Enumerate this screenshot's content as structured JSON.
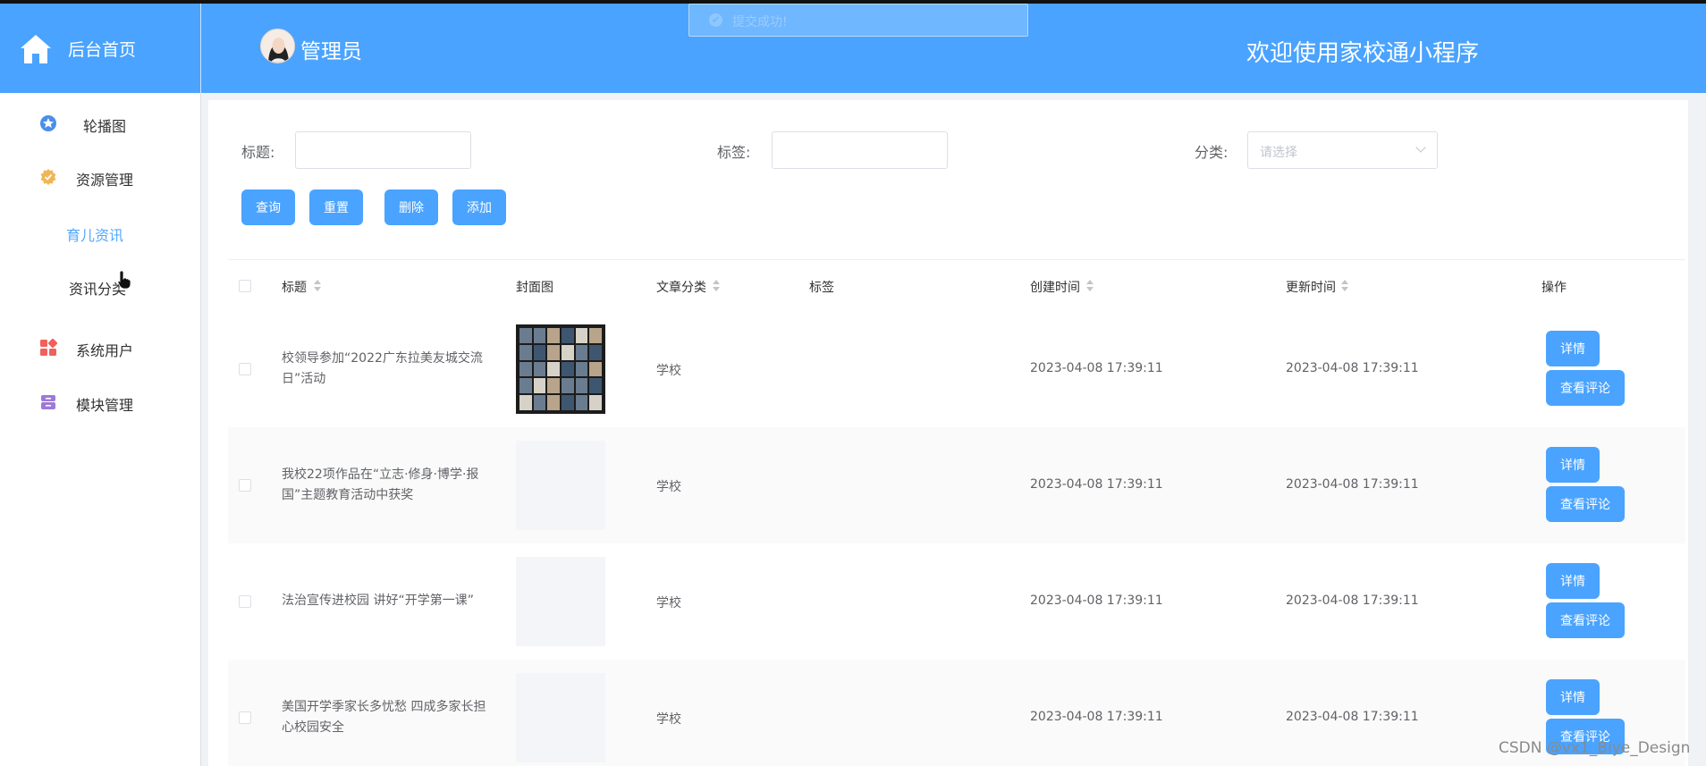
{
  "header": {
    "home_label": "后台首页",
    "admin_name": "管理员",
    "welcome": "欢迎使用家校通小程序",
    "toast_text": "提交成功!",
    "bg_color": "#4aa3ff"
  },
  "sidebar": {
    "items": [
      {
        "label": "轮播图",
        "icon": "star-badge-icon"
      },
      {
        "label": "资源管理",
        "icon": "gear-badge-icon"
      },
      {
        "label": "育儿资讯",
        "icon": ""
      },
      {
        "label": "资讯分类",
        "icon": ""
      },
      {
        "label": "系统用户",
        "icon": "grid-icon"
      },
      {
        "label": "模块管理",
        "icon": "archive-icon"
      }
    ],
    "active_color": "#53a8ff"
  },
  "filters": {
    "title_label": "标题:",
    "tag_label": "标签:",
    "category_label": "分类:",
    "title_value": "",
    "tag_value": "",
    "category_placeholder": "请选择"
  },
  "actions": {
    "query": "查询",
    "reset": "重置",
    "delete": "删除",
    "add": "添加"
  },
  "table": {
    "columns": [
      "标题",
      "封面图",
      "文章分类",
      "标签",
      "创建时间",
      "更新时间",
      "操作"
    ],
    "rows": [
      {
        "title": "校领导参加“2022广东拉美友城交流日”活动",
        "category": "学校",
        "tag": "",
        "created": "2023-04-08 17:39:11",
        "updated": "2023-04-08 17:39:11",
        "detail": "详情",
        "comments": "查看评论"
      },
      {
        "title": "我校22项作品在“立志·修身·博学·报国”主题教育活动中获奖",
        "category": "学校",
        "tag": "",
        "created": "2023-04-08 17:39:11",
        "updated": "2023-04-08 17:39:11",
        "detail": "详情",
        "comments": "查看评论"
      },
      {
        "title": "法治宣传进校园 讲好“开学第一课”",
        "category": "学校",
        "tag": "",
        "created": "2023-04-08 17:39:11",
        "updated": "2023-04-08 17:39:11",
        "detail": "详情",
        "comments": "查看评论"
      },
      {
        "title": "美国开学季家长多忧愁 四成多家长担心校园安全",
        "category": "学校",
        "tag": "",
        "created": "2023-04-08 17:39:11",
        "updated": "2023-04-08 17:39:11",
        "detail": "详情",
        "comments": "查看评论"
      }
    ]
  },
  "watermark": "CSDN @vx1_Biye_Design"
}
